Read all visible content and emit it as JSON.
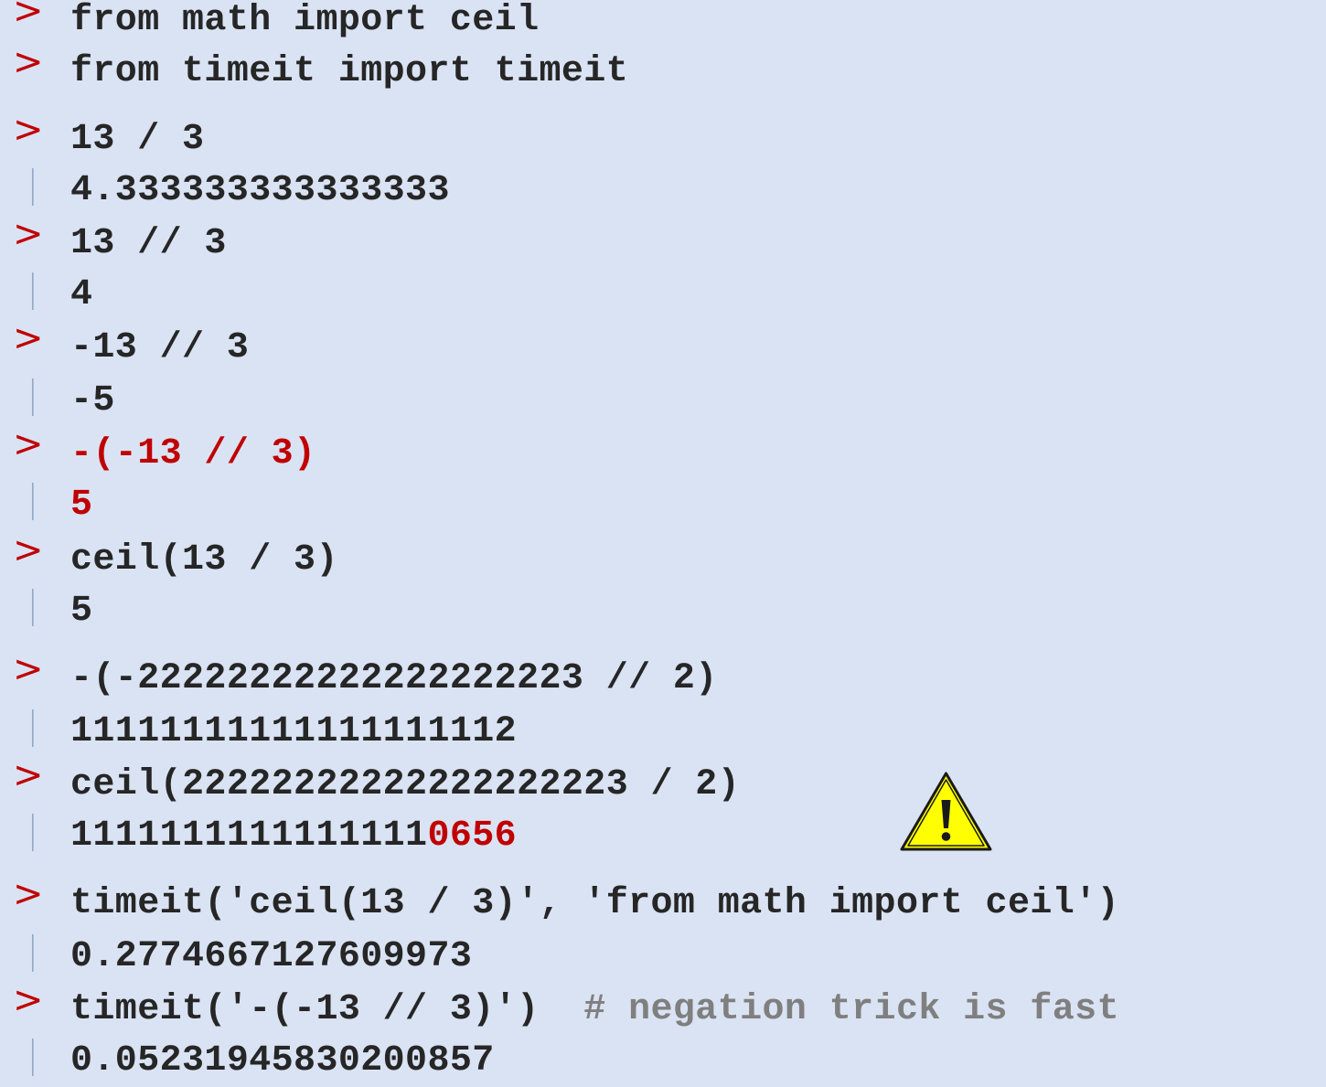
{
  "lines": [
    {
      "kind": "input",
      "text": "from math import ceil"
    },
    {
      "kind": "input",
      "text": "from timeit import timeit"
    },
    {
      "kind": "input",
      "text": "13 / 3"
    },
    {
      "kind": "output",
      "text": "4.333333333333333"
    },
    {
      "kind": "input",
      "text": "13 // 3"
    },
    {
      "kind": "output",
      "text": "4"
    },
    {
      "kind": "input",
      "text": "-13 // 3"
    },
    {
      "kind": "output",
      "text": "-5"
    },
    {
      "kind": "input",
      "text": "-(-13 // 3)",
      "highlight": true
    },
    {
      "kind": "output",
      "text": "5",
      "highlight": true
    },
    {
      "kind": "input",
      "text": "ceil(13 / 3)"
    },
    {
      "kind": "output",
      "text": "5"
    },
    {
      "kind": "input",
      "text": "-(-22222222222222222223 // 2)"
    },
    {
      "kind": "output",
      "text": "11111111111111111112"
    },
    {
      "kind": "input",
      "text": "ceil(22222222222222222223 / 2)"
    },
    {
      "kind": "output",
      "text": "1111111111111111",
      "suffix": "0656"
    },
    {
      "kind": "input",
      "text": "timeit('ceil(13 / 3)', 'from math import ceil')"
    },
    {
      "kind": "output",
      "text": "0.2774667127609973"
    },
    {
      "kind": "input",
      "text": "timeit('-(-13 // 3)')",
      "comment": "  # negation trick is fast"
    },
    {
      "kind": "output",
      "text": "0.05231945830200857"
    }
  ],
  "markers": {
    "prompt": ">",
    "output": "|"
  },
  "colors": {
    "background": "#dae3f3",
    "text": "#262626",
    "highlight": "#c00000",
    "comment": "#7f7f7f",
    "output_bar": "#8fa8c8",
    "warning_fill": "#ffff00"
  },
  "warning_icon": "warning-triangle-icon"
}
